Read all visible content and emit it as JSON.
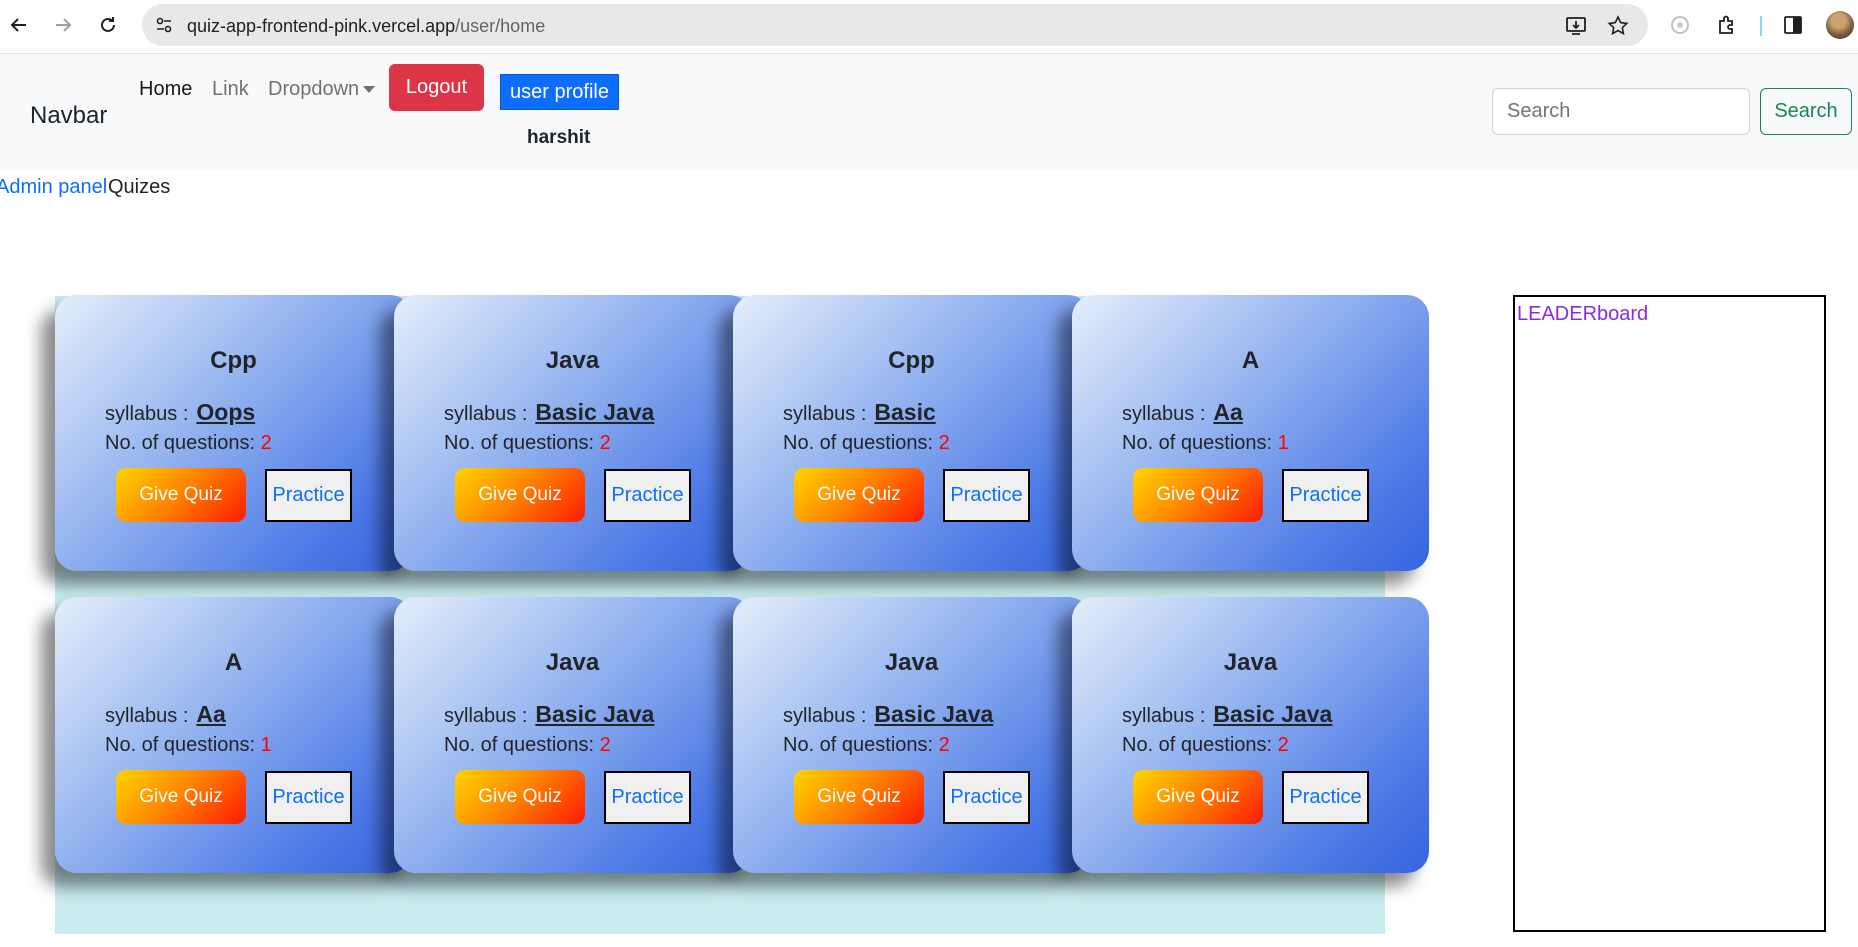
{
  "browser": {
    "url_host": "quiz-app-frontend-pink.vercel.app",
    "url_path": "/user/home"
  },
  "navbar": {
    "brand": "Navbar",
    "links": [
      "Home",
      "Link",
      "Dropdown"
    ],
    "logout_label": "Logout",
    "profile_label": "user profile",
    "username": "harshit",
    "search_placeholder": "Search",
    "search_button": "Search"
  },
  "breadcrumb": {
    "admin_link": "Admin panel",
    "current": "Quizes"
  },
  "labels": {
    "syllabus": "syllabus :",
    "num_questions": "No. of questions:",
    "give_quiz": "Give Quiz",
    "practice": "Practice"
  },
  "quizzes": [
    {
      "title": "Cpp",
      "syllabus": "Oops",
      "questions": "2"
    },
    {
      "title": "Java",
      "syllabus": "Basic Java",
      "questions": "2"
    },
    {
      "title": "Cpp",
      "syllabus": "Basic",
      "questions": "2"
    },
    {
      "title": "A",
      "syllabus": "Aa",
      "questions": "1"
    },
    {
      "title": "A",
      "syllabus": "Aa",
      "questions": "1"
    },
    {
      "title": "Java",
      "syllabus": "Basic Java",
      "questions": "2"
    },
    {
      "title": "Java",
      "syllabus": "Basic Java",
      "questions": "2"
    },
    {
      "title": "Java",
      "syllabus": "Basic Java",
      "questions": "2"
    }
  ],
  "leaderboard": {
    "title": "LEADERboard"
  },
  "colors": {
    "logout": "#dc3545",
    "profile": "#0d6efd",
    "search": "#198754",
    "count": "#ff0000",
    "leaderboard_title": "#8a2be2"
  }
}
